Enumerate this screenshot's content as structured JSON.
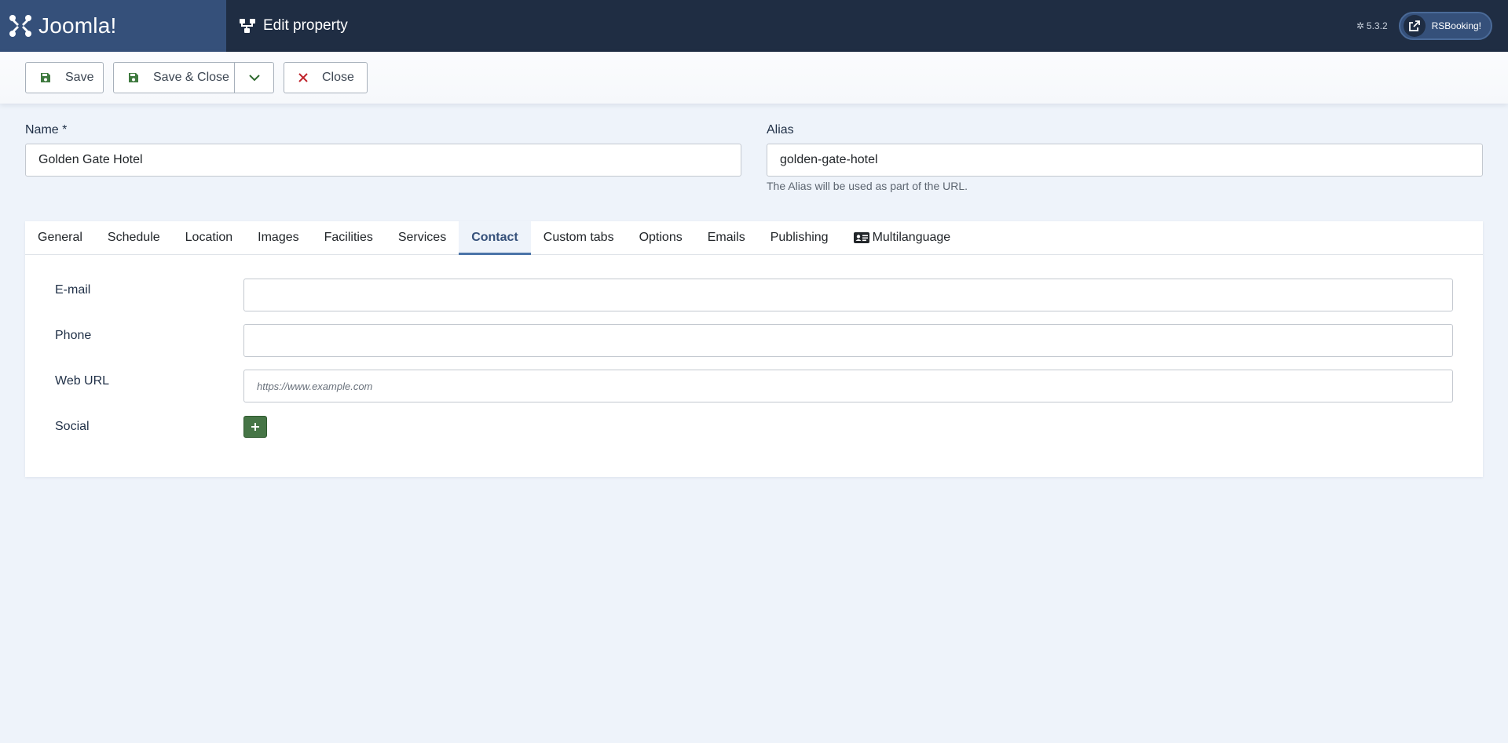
{
  "header": {
    "logo_text": "Joomla!",
    "page_title": "Edit property",
    "version": "5.3.2",
    "site_button_label": "RSBooking!"
  },
  "toolbar": {
    "save_label": "Save",
    "save_close_label": "Save & Close",
    "close_label": "Close"
  },
  "form": {
    "name_label": "Name *",
    "name_value": "Golden Gate Hotel",
    "alias_label": "Alias",
    "alias_value": "golden-gate-hotel",
    "alias_hint": "The Alias will be used as part of the URL."
  },
  "tabs": [
    {
      "label": "General"
    },
    {
      "label": "Schedule"
    },
    {
      "label": "Location"
    },
    {
      "label": "Images"
    },
    {
      "label": "Facilities"
    },
    {
      "label": "Services"
    },
    {
      "label": "Contact",
      "active": true
    },
    {
      "label": "Custom tabs"
    },
    {
      "label": "Options"
    },
    {
      "label": "Emails"
    },
    {
      "label": "Publishing"
    },
    {
      "label": "Multilanguage",
      "icon": "id-card-icon"
    }
  ],
  "contact": {
    "email_label": "E-mail",
    "email_value": "",
    "phone_label": "Phone",
    "phone_value": "",
    "web_url_label": "Web URL",
    "web_url_placeholder": "https://www.example.com",
    "social_label": "Social"
  },
  "colors": {
    "header_bg": "#1f2d43",
    "logo_bg": "#35507a",
    "page_bg": "#eef3fa",
    "save_icon": "#3f7a3f",
    "close_icon": "#c0242b",
    "add_button": "#467546",
    "active_tab": "#35507a"
  }
}
